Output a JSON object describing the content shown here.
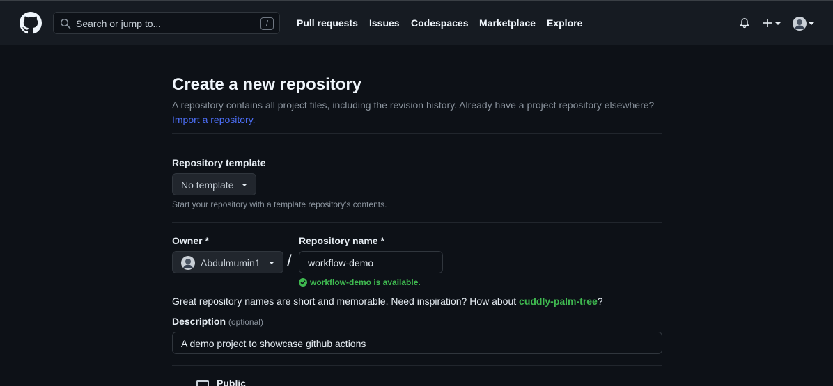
{
  "header": {
    "search_placeholder": "Search or jump to...",
    "search_shortcut": "/",
    "nav": [
      "Pull requests",
      "Issues",
      "Codespaces",
      "Marketplace",
      "Explore"
    ]
  },
  "page": {
    "title": "Create a new repository",
    "subtitle": "A repository contains all project files, including the revision history. Already have a project repository elsewhere?",
    "import_link": "Import a repository."
  },
  "template": {
    "label": "Repository template",
    "selected": "No template",
    "note": "Start your repository with a template repository's contents."
  },
  "owner": {
    "label": "Owner *",
    "selected": "Abdulmumin1"
  },
  "repo": {
    "label": "Repository name *",
    "value": "workflow-demo",
    "availability": "workflow-demo is available."
  },
  "separator": "/",
  "hint": {
    "prefix": "Great repository names are short and memorable. Need inspiration? How about ",
    "suggestion": "cuddly-palm-tree",
    "suffix": "?"
  },
  "description": {
    "label": "Description",
    "optional": "(optional)",
    "value": "A demo project to showcase github actions"
  },
  "visibility": {
    "public_label": "Public"
  },
  "colors": {
    "background": "#0d1117",
    "header": "#161b22",
    "link": "#4c6ef5",
    "success": "#3fb950"
  }
}
